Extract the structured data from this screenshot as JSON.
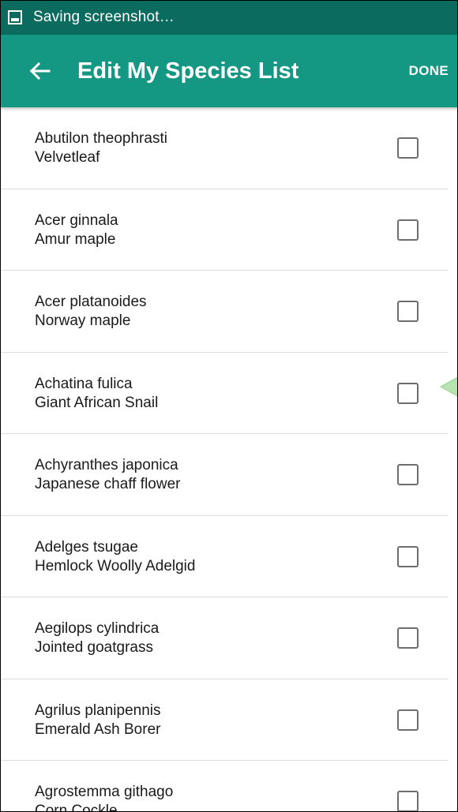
{
  "status_bar": {
    "text": "Saving screenshot…",
    "icon": "image-icon"
  },
  "app_bar": {
    "title": "Edit My Species List",
    "back_icon": "arrow-left-icon",
    "done_label": "DONE"
  },
  "colors": {
    "status_bar": "#0b6b5e",
    "app_bar": "#149884",
    "text": "#1a1a1a",
    "divider": "#dcdcdc",
    "checkbox_border": "#6d6d6d",
    "scroll_indicator": "#b6e3b0"
  },
  "species": [
    {
      "scientific": "Abutilon theophrasti",
      "common": "Velvetleaf",
      "checked": false
    },
    {
      "scientific": "Acer ginnala",
      "common": "Amur maple",
      "checked": false
    },
    {
      "scientific": "Acer platanoides",
      "common": "Norway maple",
      "checked": false
    },
    {
      "scientific": "Achatina fulica",
      "common": "Giant African Snail",
      "checked": false
    },
    {
      "scientific": "Achyranthes japonica",
      "common": "Japanese chaff flower",
      "checked": false
    },
    {
      "scientific": "Adelges tsugae",
      "common": "Hemlock Woolly Adelgid",
      "checked": false
    },
    {
      "scientific": "Aegilops cylindrica",
      "common": "Jointed goatgrass",
      "checked": false
    },
    {
      "scientific": "Agrilus planipennis",
      "common": "Emerald Ash Borer",
      "checked": false
    },
    {
      "scientific": "Agrostemma githago",
      "common": "Corn Cockle",
      "checked": false
    }
  ]
}
